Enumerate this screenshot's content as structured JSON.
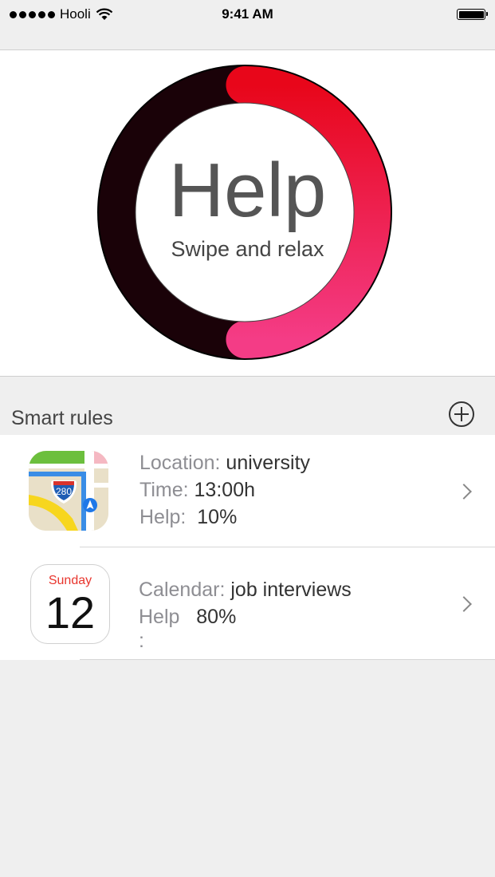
{
  "status_bar": {
    "carrier": "Hooli",
    "time": "9:41 AM"
  },
  "hero": {
    "title": "Help",
    "subtitle": "Swipe and relax",
    "progress_fraction": 0.5,
    "colors": {
      "ring_dark": "#1a0208",
      "ring_start": "#e8061a",
      "ring_end": "#f43c86"
    }
  },
  "smart_rules": {
    "title": "Smart rules",
    "add_icon": "plus-circle-icon",
    "items": [
      {
        "icon": "maps-app-icon",
        "road_sign": "280",
        "lines": [
          {
            "label": "Location:",
            "value": "university"
          },
          {
            "label": "Time:",
            "value": "13:00h"
          },
          {
            "label": "Help:",
            "value": "10%"
          }
        ]
      },
      {
        "icon": "calendar-app-icon",
        "calendar_day": "Sunday",
        "calendar_date": "12",
        "lines": [
          {
            "label": "Calendar:",
            "value": "job interviews"
          },
          {
            "label": "Help",
            "value": "80%"
          },
          {
            "label": ":",
            "value": ""
          }
        ]
      }
    ]
  }
}
